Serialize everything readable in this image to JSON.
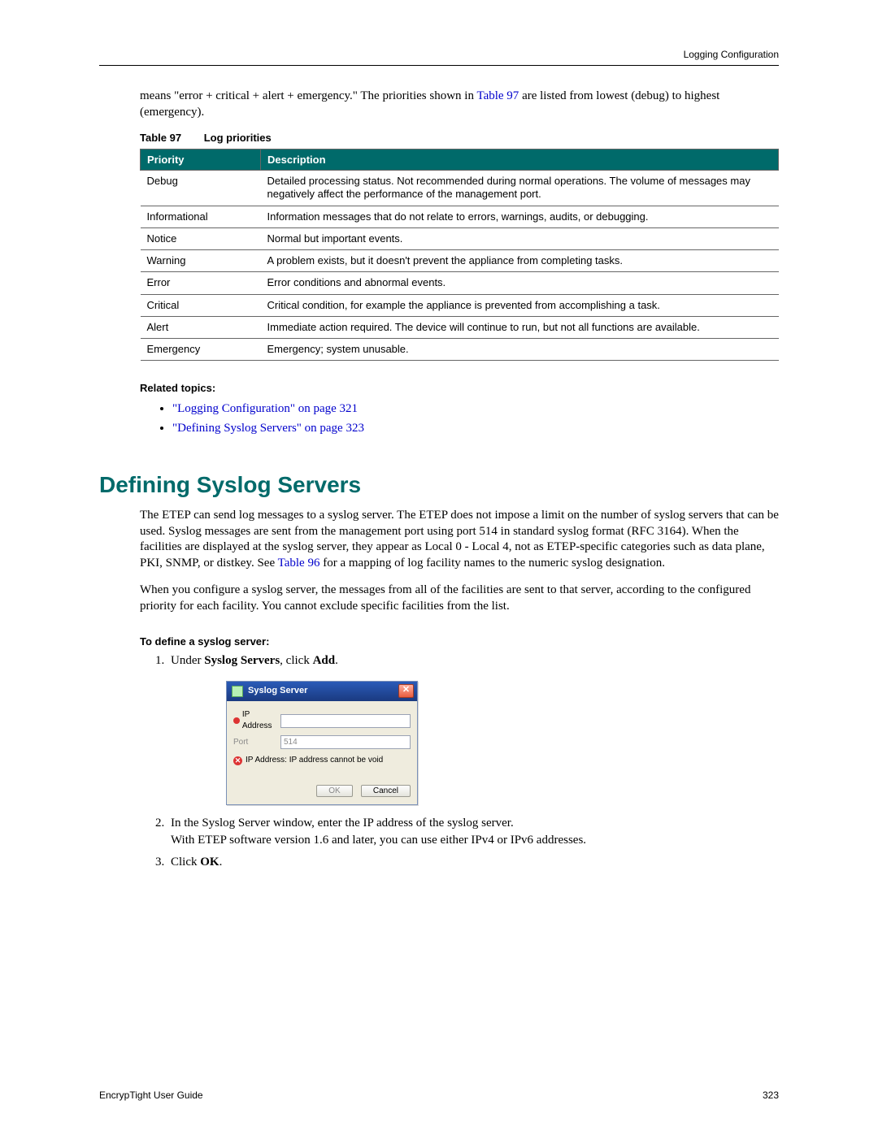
{
  "header": {
    "section": "Logging Configuration"
  },
  "intro_paragraph": {
    "pre": "means \"error + critical + alert + emergency.\" The priorities shown in ",
    "link": "Table 97",
    "post": " are listed from lowest (debug) to highest (emergency)."
  },
  "table": {
    "caption_prefix": "Table 97",
    "caption_title": "Log priorities",
    "headers": {
      "priority": "Priority",
      "description": "Description"
    },
    "rows": [
      {
        "priority": "Debug",
        "description": "Detailed processing status. Not recommended during normal operations. The volume of messages may negatively affect the performance of the management port."
      },
      {
        "priority": "Informational",
        "description": "Information messages that do not relate to errors, warnings, audits, or debugging."
      },
      {
        "priority": "Notice",
        "description": "Normal but important events."
      },
      {
        "priority": "Warning",
        "description": "A problem exists, but it doesn't prevent the appliance from completing tasks."
      },
      {
        "priority": "Error",
        "description": "Error conditions and abnormal events."
      },
      {
        "priority": "Critical",
        "description": "Critical condition, for example the appliance is prevented from accomplishing a task."
      },
      {
        "priority": "Alert",
        "description": "Immediate action required. The device will continue to run, but not all functions are available."
      },
      {
        "priority": "Emergency",
        "description": "Emergency; system unusable."
      }
    ]
  },
  "related": {
    "heading": "Related topics:",
    "items": [
      "\"Logging Configuration\" on page 321",
      "\"Defining Syslog Servers\" on page 323"
    ]
  },
  "section_title": "Defining Syslog Servers",
  "para1": {
    "text": "The ETEP can send log messages to a syslog server. The ETEP does not impose a limit on the number of syslog servers that can be used. Syslog messages are sent from the management port using port 514 in standard syslog format (RFC 3164). When the facilities are displayed at the syslog server, they appear as Local 0 - Local 4, not as ETEP-specific categories such as data plane, PKI, SNMP, or distkey. See ",
    "link": "Table 96",
    "post": " for a mapping of log facility names to the numeric syslog designation."
  },
  "para2": "When you configure a syslog server, the messages from all of the facilities are sent to that server, according to the configured priority for each facility. You cannot exclude specific facilities from the list.",
  "procedure": {
    "heading": "To define a syslog server:",
    "step1_pre": "Under ",
    "step1_bold1": "Syslog Servers",
    "step1_mid": ", click ",
    "step1_bold2": "Add",
    "step1_post": ".",
    "step2_line1": "In the Syslog Server window, enter the IP address of the syslog server.",
    "step2_line2": "With ETEP software version 1.6 and later, you can use either IPv4 or IPv6 addresses.",
    "step3_pre": "Click ",
    "step3_bold": "OK",
    "step3_post": "."
  },
  "dialog": {
    "title": "Syslog Server",
    "ip_label": "IP Address",
    "port_label": "Port",
    "port_value": "514",
    "error": "IP Address: IP address cannot be void",
    "ok": "OK",
    "cancel": "Cancel",
    "close_glyph": "✕"
  },
  "footer": {
    "left": "EncrypTight User Guide",
    "right": "323"
  }
}
